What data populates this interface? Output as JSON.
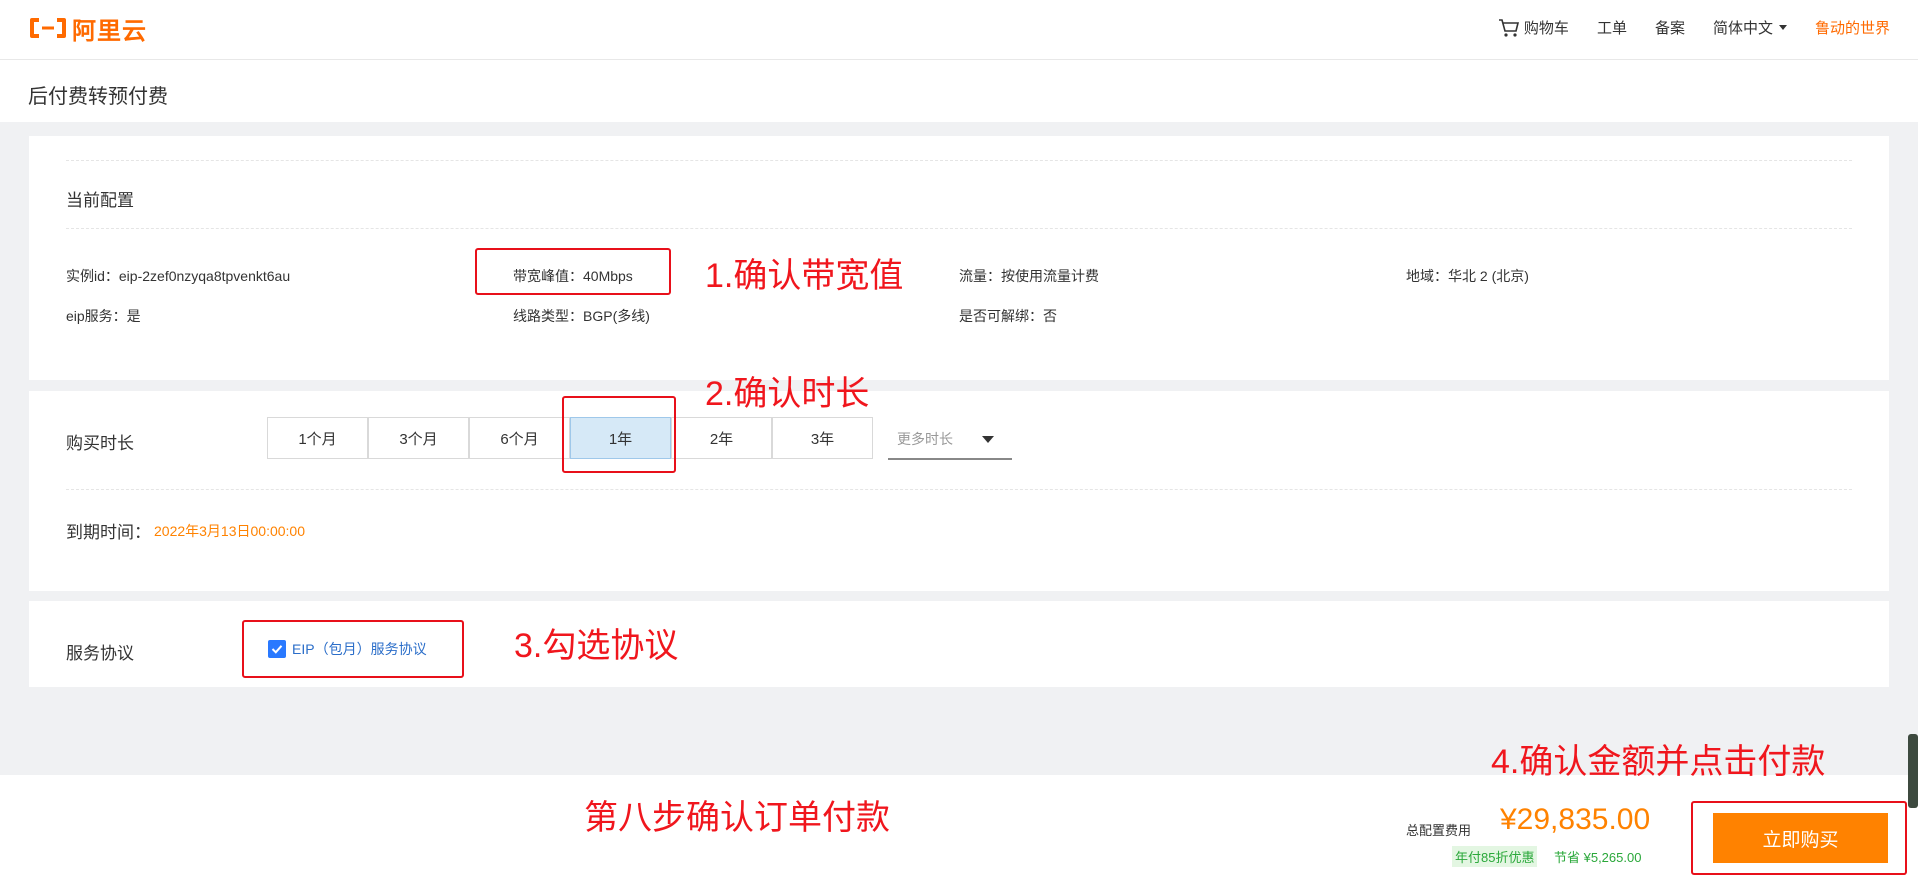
{
  "nav": {
    "logo_text": "阿里云",
    "cart": "购物车",
    "ticket": "工单",
    "beian": "备案",
    "language": "简体中文",
    "user": "鲁动的世界"
  },
  "page_title": "后付费转预付费",
  "current_config": {
    "label": "当前配置",
    "instance_id": "实例id：eip-2zef0nzyqa8tpvenkt6au",
    "bandwidth": "带宽峰值：40Mbps",
    "traffic": "流量：按使用流量计费",
    "region": "地域：华北 2 (北京)",
    "eip_service": "eip服务：是",
    "line_type": "线路类型：BGP(多线)",
    "unbindable": "是否可解绑：否"
  },
  "purchase": {
    "label": "购买时长",
    "options": [
      "1个月",
      "3个月",
      "6个月",
      "1年",
      "2年",
      "3年"
    ],
    "selected": "1年",
    "more_placeholder": "更多时长",
    "expire_label": "到期时间：",
    "expire_value": "2022年3月13日00:00:00"
  },
  "agreement": {
    "label": "服务协议",
    "link": "EIP（包月）服务协议",
    "checked": true
  },
  "footer": {
    "total_label": "总配置费用",
    "total_price": "¥29,835.00",
    "discount_badge": "年付85折优惠",
    "saving": "节省 ¥5,265.00",
    "buy_button": "立即购买"
  },
  "annotations": {
    "a1": "1.确认带宽值",
    "a2": "2.确认时长",
    "a3": "3.勾选协议",
    "a4": "4.确认金额并点击付款",
    "step": "第八步确认订单付款"
  },
  "colors": {
    "brand": "#ff6a00",
    "buy_button": "#ff8200",
    "annotation_red": "#f0161d",
    "checkbox_blue": "#2979ff",
    "price_orange": "#ff8200",
    "discount_green": "#2aa83a"
  }
}
